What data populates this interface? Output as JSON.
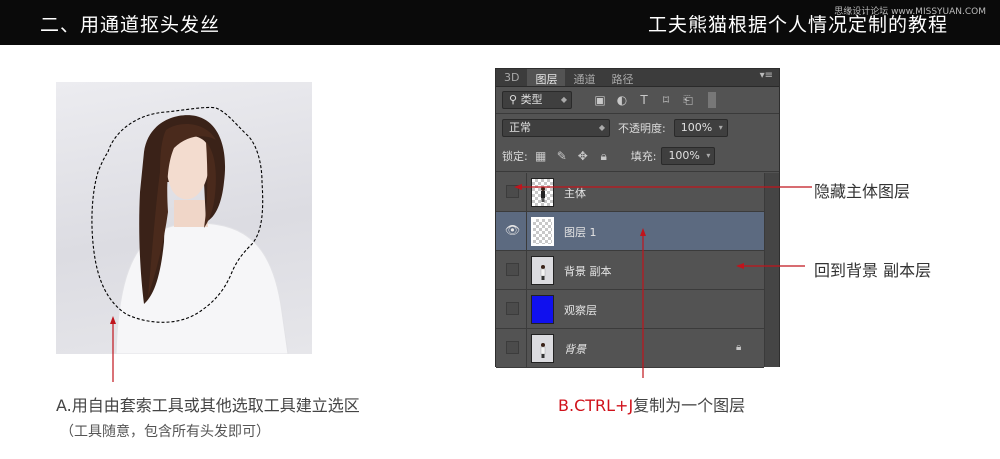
{
  "header": {
    "title": "二、用通道抠头发丝",
    "subtitle": "工夫熊猫根据个人情况定制的教程",
    "watermark": "思缘设计论坛 www.MISSYUAN.COM"
  },
  "panel": {
    "tabs": [
      "3D",
      "图层",
      "通道",
      "路径"
    ],
    "active_tab": "图层",
    "filter_label": "类型",
    "blend_mode": "正常",
    "opacity_label": "不透明度:",
    "opacity_value": "100%",
    "lock_label": "锁定:",
    "fill_label": "填充:",
    "fill_value": "100%",
    "layers": [
      {
        "name": "主体",
        "visible": false,
        "selected": false
      },
      {
        "name": "图层 1",
        "visible": true,
        "selected": true
      },
      {
        "name": "背景 副本",
        "visible": false,
        "selected": false
      },
      {
        "name": "观察层",
        "visible": false,
        "selected": false
      },
      {
        "name": "背景",
        "visible": false,
        "selected": false,
        "locked": true
      }
    ]
  },
  "annotations": {
    "hide_main": "隐藏主体图层",
    "back_to_bg": "回到背景 副本层",
    "caption_a": "A.用自由套索工具或其他选取工具建立选区",
    "caption_a_sub": "（工具随意，包含所有头发即可）",
    "caption_b_prefix": "B.",
    "caption_b_key": "CTRL+J",
    "caption_b_rest": "复制为一个图层"
  },
  "colors": {
    "annotation_line": "#c0141c",
    "highlight_text": "#d0121b",
    "panel_bg": "#535353",
    "selected_layer": "#5c6a80",
    "topbar_bg": "#0a0a0a"
  }
}
